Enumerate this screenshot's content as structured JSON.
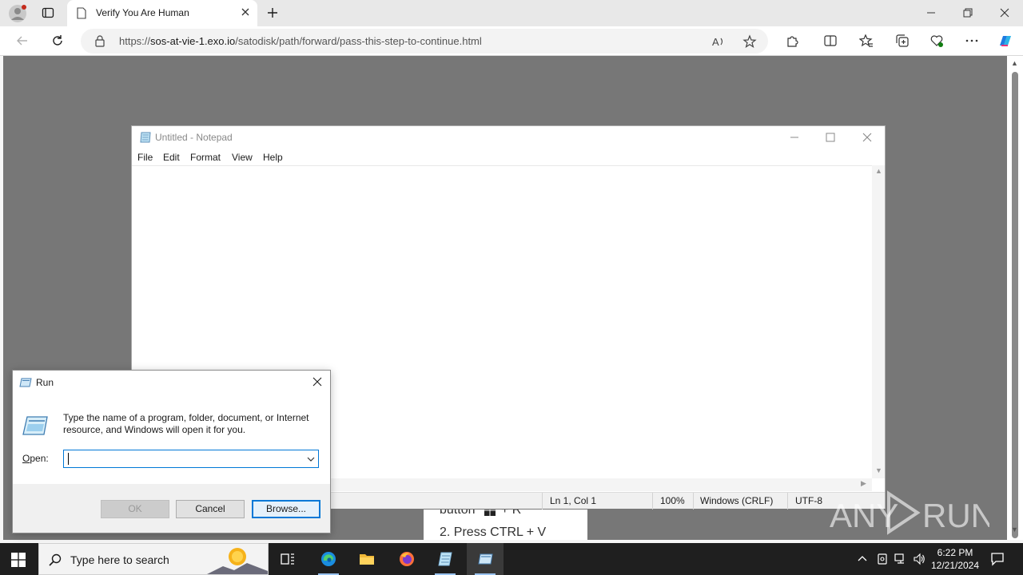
{
  "browser": {
    "tab_title": "Verify You Are Human",
    "url_prefix": "https://",
    "url_host": "sos-at-vie-1.exo.io",
    "url_path": "/satodisk/path/forward/pass-this-step-to-continue.html",
    "icons": [
      "profile-icon",
      "tab-actions-icon",
      "page-icon",
      "close-tab-icon",
      "new-tab-icon",
      "back-icon",
      "refresh-icon",
      "lock-icon",
      "read-aloud-icon",
      "favorite-icon",
      "extensions-icon",
      "split-screen-icon",
      "favorites-icon",
      "collections-icon",
      "browser-essentials-icon",
      "more-icon",
      "copilot-icon"
    ]
  },
  "page": {
    "instruction_line1": "button",
    "instruction_line1_suffix": "+ R",
    "instruction_line2": "2. Press CTRL + V"
  },
  "notepad": {
    "title": "Untitled - Notepad",
    "menu": [
      "File",
      "Edit",
      "Format",
      "View",
      "Help"
    ],
    "content": "",
    "status": {
      "position": "Ln 1, Col 1",
      "zoom": "100%",
      "line_ending": "Windows (CRLF)",
      "encoding": "UTF-8"
    }
  },
  "run_dialog": {
    "title": "Run",
    "description": "Type the name of a program, folder, document, or Internet resource, and Windows will open it for you.",
    "open_label_underlined": "O",
    "open_label_rest": "pen:",
    "open_value": "",
    "ok_label": "OK",
    "cancel_label": "Cancel",
    "browse_label": "Browse..."
  },
  "watermark": {
    "text_left": "ANY",
    "text_right": "RUN"
  },
  "taskbar": {
    "search_placeholder": "Type here to search",
    "apps": [
      "task-view",
      "edge",
      "file-explorer",
      "firefox",
      "notepad",
      "run"
    ],
    "time": "6:22 PM",
    "date": "12/21/2024"
  },
  "colors": {
    "viewport_bg": "#777777",
    "taskbar_bg": "#1f1f1f",
    "accent": "#0078d7"
  }
}
